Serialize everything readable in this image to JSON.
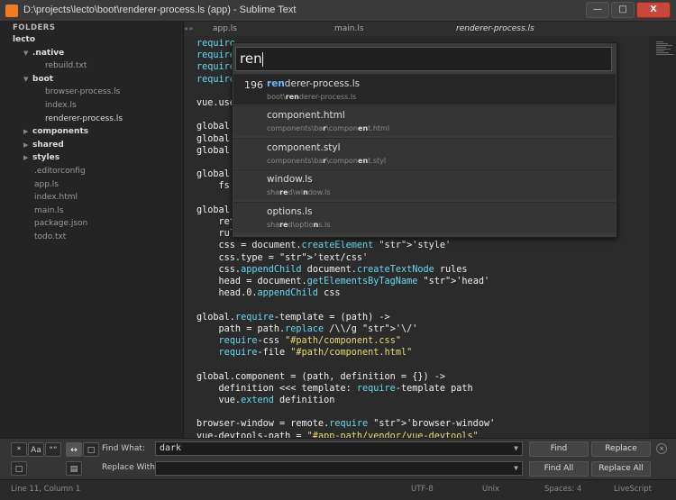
{
  "window": {
    "title": "D:\\projects\\lecto\\boot\\renderer-process.ls (app) - Sublime Text",
    "minimize": "—",
    "maximize": "□",
    "close": "X"
  },
  "sidebar": {
    "header": "FOLDERS",
    "items": [
      {
        "label": "lecto",
        "kind": "folder",
        "expanded": true
      },
      {
        "label": ".native",
        "kind": "folder",
        "expanded": true
      },
      {
        "label": "rebuild.txt",
        "kind": "file"
      },
      {
        "label": "boot",
        "kind": "folder",
        "expanded": true
      },
      {
        "label": "browser-process.ls",
        "kind": "file"
      },
      {
        "label": "index.ls",
        "kind": "file"
      },
      {
        "label": "renderer-process.ls",
        "kind": "file",
        "selected": true
      },
      {
        "label": "components",
        "kind": "folder",
        "expanded": false
      },
      {
        "label": "shared",
        "kind": "folder",
        "expanded": false
      },
      {
        "label": "styles",
        "kind": "folder",
        "expanded": false
      },
      {
        "label": ".editorconfig",
        "kind": "file"
      },
      {
        "label": "app.ls",
        "kind": "file"
      },
      {
        "label": "index.html",
        "kind": "file"
      },
      {
        "label": "main.ls",
        "kind": "file"
      },
      {
        "label": "package.json",
        "kind": "file"
      },
      {
        "label": "todo.txt",
        "kind": "file"
      }
    ]
  },
  "tabs": [
    {
      "label": "app.ls",
      "active": false
    },
    {
      "label": "main.ls",
      "active": false
    },
    {
      "label": "renderer-process.ls",
      "active": true
    }
  ],
  "tab_nav": "◂ ▸",
  "code": [
    "require",
    "require",
    "require",
    "require",
    "",
    "vue.use",
    "",
    "global.",
    "global.",
    "global.",
    "",
    "global.",
    "    fs.",
    "",
    "global.",
    "    ret",
    "    rule",
    "    css = document.createElement 'style'",
    "    css.type = 'text/css'",
    "    css.appendChild document.createTextNode rules",
    "    head = document.getElementsByTagName 'head'",
    "    head.0.appendChild css",
    "",
    "global.require-template = (path) ->",
    "    path = path.replace /\\\\/g '\\/'",
    "    require-css \"#path/component.css\"",
    "    require-file \"#path/component.html\"",
    "",
    "global.component = (path, definition = {}) ->",
    "    definition <<< template: require-template path",
    "    vue.extend definition",
    "",
    "browser-window = remote.require 'browser-window'",
    "vue-devtools-path = \"#app-path/vendor/vue-devtools\""
  ],
  "quick_open": {
    "query": "ren",
    "results": [
      {
        "count": "196",
        "name": "renderer-process.ls",
        "path": "boot\\renderer-process.ls",
        "selected": true
      },
      {
        "count": "",
        "name": "component.html",
        "path": "components\\bar\\component.html",
        "selected": false
      },
      {
        "count": "",
        "name": "component.styl",
        "path": "components\\bar\\component.styl",
        "selected": false
      },
      {
        "count": "",
        "name": "window.ls",
        "path": "shared\\window.ls",
        "selected": false
      },
      {
        "count": "",
        "name": "options.ls",
        "path": "shared\\options.ls",
        "selected": false
      }
    ]
  },
  "find": {
    "find_label": "Find What:",
    "find_value": "dark",
    "replace_label": "Replace With:",
    "replace_value": "",
    "find_button": "Find",
    "replace_button": "Replace",
    "find_all_button": "Find All",
    "replace_all_button": "Replace All",
    "toggles": [
      "*",
      "Aa",
      "““",
      "↔",
      "□"
    ],
    "close": "×"
  },
  "status": {
    "position": "Line 11, Column 1",
    "encoding": "UTF-8",
    "line_endings": "Unix",
    "indent": "Spaces: 4",
    "syntax": "LiveScript"
  }
}
